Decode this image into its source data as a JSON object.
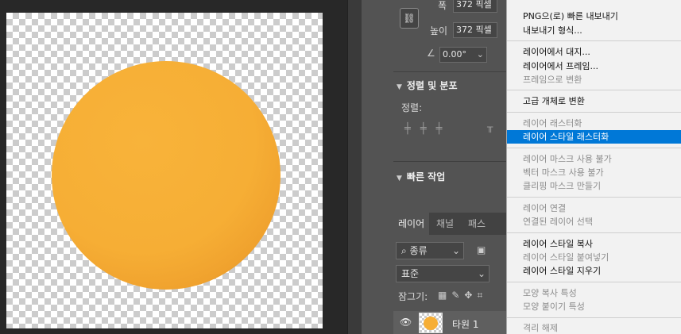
{
  "properties": {
    "width_label": "폭",
    "width_value": "372 픽셀",
    "height_label": "높이",
    "height_value": "372 픽셀",
    "angle_value": "0.00°",
    "align_section_title": "정렬 및 분포",
    "align_label": "정렬:",
    "quick_actions_title": "빠른 작업"
  },
  "layers": {
    "tabs": [
      "레이어",
      "채널",
      "패스"
    ],
    "filter_kind": "종류",
    "blend_mode": "표준",
    "lock_label": "잠그기:",
    "layer_name": "타원 1"
  },
  "menu": {
    "items": [
      {
        "label": "PNG으(로) 빠른 내보내기",
        "disabled": false
      },
      {
        "label": "내보내기 형식...",
        "disabled": false
      },
      {
        "label": "레이어에서 대지...",
        "disabled": false
      },
      {
        "label": "레이어에서 프레임...",
        "disabled": false
      },
      {
        "label": "프레임으로 변환",
        "disabled": true
      },
      {
        "label": "고급 개체로 변환",
        "disabled": false
      },
      {
        "label": "레이어 래스터화",
        "disabled": true
      },
      {
        "label": "레이어 스타일 래스터화",
        "disabled": false,
        "highlighted": true
      },
      {
        "label": "레이어 마스크 사용 불가",
        "disabled": true
      },
      {
        "label": "벡터 마스크 사용 불가",
        "disabled": true
      },
      {
        "label": "클리핑 마스크 만들기",
        "disabled": true
      },
      {
        "label": "레이어 연결",
        "disabled": true
      },
      {
        "label": "연결된 레이어 선택",
        "disabled": true
      },
      {
        "label": "레이어 스타일 복사",
        "disabled": false
      },
      {
        "label": "레이어 스타일 붙여넣기",
        "disabled": true
      },
      {
        "label": "레이어 스타일 지우기",
        "disabled": false
      },
      {
        "label": "모양 복사 특성",
        "disabled": true
      },
      {
        "label": "모양 붙이기 특성",
        "disabled": true
      },
      {
        "label": "격리 해제",
        "disabled": true
      }
    ]
  },
  "colors": {
    "sphere": "#f6ae35",
    "highlight": "#0078d7"
  }
}
